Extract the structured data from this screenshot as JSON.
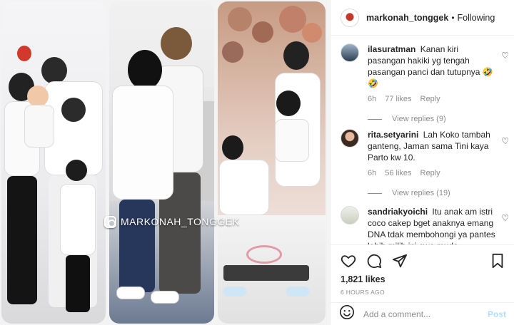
{
  "photo": {
    "watermark_text": "MARKONAH_TONGGEK",
    "panels": [
      "left-photo-family",
      "middle-photo-couple",
      "right-photo-birthday"
    ]
  },
  "post": {
    "username": "markonah_tonggek",
    "separator": "•",
    "follow_state": "Following"
  },
  "comments": [
    {
      "username": "ilasuratman",
      "text": "Kanan kiri pasangan hakiki yg tengah pasangan panci dan tutupnya 🤣🤣",
      "age": "6h",
      "likes": "77 likes",
      "reply_label": "Reply",
      "view_replies": "View replies (9)"
    },
    {
      "username": "rita.setyarini",
      "text": "Lah Koko tambah ganteng, Jaman sama Tini kaya Parto kw 10.",
      "age": "6h",
      "likes": "56 likes",
      "reply_label": "Reply",
      "view_replies": "View replies (19)"
    },
    {
      "username": "sandriakyoichi",
      "text": "Itu anak am istri coco cakep bget anaknya emang DNA tdak membohongi ya pantes lebih milih ini cwe muda"
    }
  ],
  "actions": {
    "likes_count": "1,821 likes",
    "time_ago": "6 HOURS AGO"
  },
  "add_comment": {
    "placeholder": "Add a comment...",
    "post_label": "Post"
  },
  "icons": {
    "like": "heart-icon",
    "comment": "comment-icon",
    "share": "send-icon",
    "save": "bookmark-icon",
    "emoji": "emoji-icon",
    "comment_like": "heart-small-icon"
  },
  "colors": {
    "text": "#262626",
    "muted": "#8e8e8e",
    "border": "#efefef",
    "post_disabled": "#b2dffc"
  }
}
